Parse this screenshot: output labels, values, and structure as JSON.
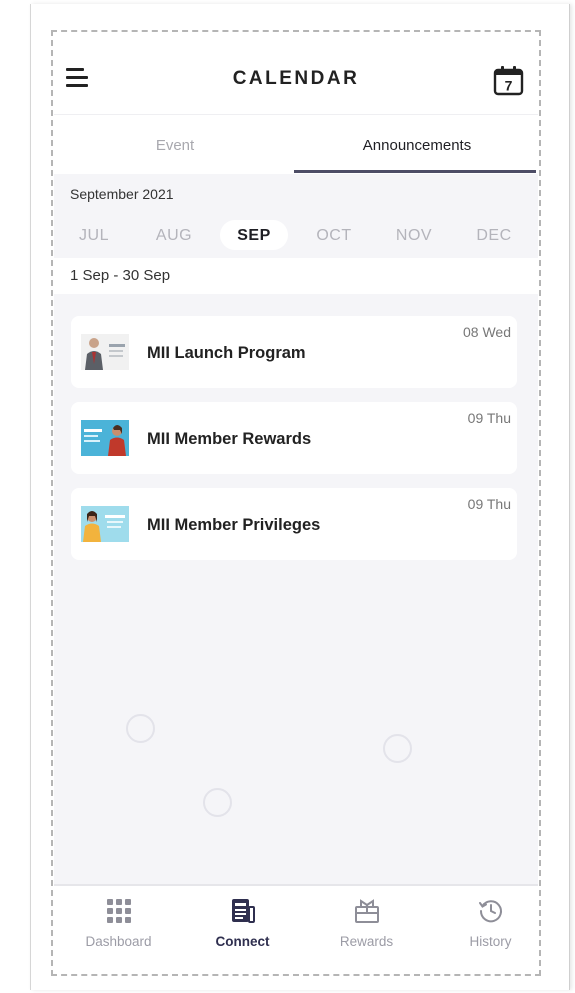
{
  "header": {
    "title": "CALENDAR",
    "calendar_day": "7"
  },
  "tabs": [
    {
      "label": "Event",
      "active": false
    },
    {
      "label": "Announcements",
      "active": true
    }
  ],
  "period": {
    "month_label": "September 2021",
    "months": [
      "JUL",
      "AUG",
      "SEP",
      "OCT",
      "NOV",
      "DEC"
    ],
    "selected_month": "SEP",
    "range": "1 Sep - 30 Sep"
  },
  "announcements": [
    {
      "title": "MII Launch Program",
      "date": "08 Wed",
      "thumbnail": "person-in-suit-banner"
    },
    {
      "title": "MII Member Rewards",
      "date": "09 Thu",
      "thumbnail": "blue-banner-woman"
    },
    {
      "title": "MII Member Privileges",
      "date": "09 Thu",
      "thumbnail": "light-blue-banner-woman"
    }
  ],
  "bottom_nav": [
    {
      "label": "Dashboard",
      "icon": "grid-icon",
      "active": false
    },
    {
      "label": "Connect",
      "icon": "newspaper-icon",
      "active": true
    },
    {
      "label": "Rewards",
      "icon": "gift-icon",
      "active": false
    },
    {
      "label": "History",
      "icon": "history-icon",
      "active": false
    }
  ],
  "colors": {
    "accent": "#2f2f4f",
    "tab_underline": "#4d4d66",
    "background": "#f5f5f8",
    "inactive_text": "#a8a8ae"
  }
}
